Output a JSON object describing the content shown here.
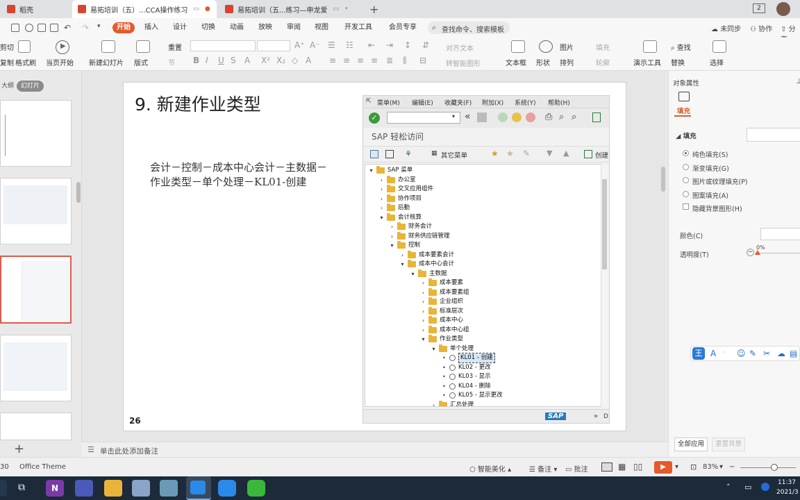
{
  "tabs": [
    {
      "label": "稻壳",
      "icon": "wps-logo-icon"
    },
    {
      "label": "易拓培训（五）...CCA操作练习",
      "icon": "ppt-icon"
    },
    {
      "label": "易拓培训（五...练习—申龙爱",
      "icon": "ppt-icon"
    }
  ],
  "titlebar": {
    "page_badge": "2"
  },
  "menu": {
    "items": [
      "开始",
      "插入",
      "设计",
      "切换",
      "动画",
      "放映",
      "审阅",
      "视图",
      "开发工具",
      "会员专享"
    ],
    "active": "开始",
    "search_placeholder": "查找命令、搜索模板",
    "sync": "未同步",
    "collab": "协作",
    "share": "分享"
  },
  "ribbon": {
    "cut": "剪切",
    "copy": "复制",
    "format_painter": "格式刷",
    "play_from_current": "当页开始",
    "new_slide": "新建幻灯片",
    "layout": "版式",
    "reset": "重置",
    "section": "节",
    "text_box": "文本框",
    "shape": "形状",
    "arrange": "排列",
    "picture": "图片",
    "fill": "填充",
    "outline": "轮廓",
    "find": "查找",
    "replace": "替换",
    "presentation_tools": "演示工具",
    "select": "选择",
    "align_text": "对齐文本",
    "convert_smartart": "转智能图形"
  },
  "leftpanel": {
    "outline_tab": "大纲",
    "slides_tab": "幻灯片",
    "add_label": "+"
  },
  "slide": {
    "title": "9.  新建作业类型",
    "body_line1": "会计－控制－成本中心会计－主数据－",
    "body_line2": "作业类型－单个处理－KL01-创建",
    "number": "26"
  },
  "sap": {
    "menu": [
      "菜单(M)",
      "编辑(E)",
      "收藏夹(F)",
      "附加(X)",
      "系统(Y)",
      "帮助(H)"
    ],
    "title": "SAP 轻松访问",
    "other_menu": "其它菜单",
    "create_role": "创建",
    "tree": [
      {
        "label": "SAP 菜单",
        "depth": 0,
        "toggle": "▾",
        "icon": "folder"
      },
      {
        "label": "办公室",
        "depth": 1,
        "toggle": "›",
        "icon": "folder"
      },
      {
        "label": "交叉应用组件",
        "depth": 1,
        "toggle": "›",
        "icon": "folder"
      },
      {
        "label": "协作项目",
        "depth": 1,
        "toggle": "›",
        "icon": "folder"
      },
      {
        "label": "后勤",
        "depth": 1,
        "toggle": "›",
        "icon": "folder"
      },
      {
        "label": "会计核算",
        "depth": 1,
        "toggle": "▾",
        "icon": "folder"
      },
      {
        "label": "财务会计",
        "depth": 2,
        "toggle": "›",
        "icon": "folder"
      },
      {
        "label": "财务供应链管理",
        "depth": 2,
        "toggle": "›",
        "icon": "folder"
      },
      {
        "label": "控制",
        "depth": 2,
        "toggle": "▾",
        "icon": "folder"
      },
      {
        "label": "成本要素会计",
        "depth": 3,
        "toggle": "›",
        "icon": "folder"
      },
      {
        "label": "成本中心会计",
        "depth": 3,
        "toggle": "▾",
        "icon": "folder"
      },
      {
        "label": "主数据",
        "depth": 4,
        "toggle": "▾",
        "icon": "folder"
      },
      {
        "label": "成本要素",
        "depth": 5,
        "toggle": "›",
        "icon": "folder"
      },
      {
        "label": "成本要素组",
        "depth": 5,
        "toggle": "›",
        "icon": "folder"
      },
      {
        "label": "企业组织",
        "depth": 5,
        "toggle": "›",
        "icon": "folder"
      },
      {
        "label": "标准层次",
        "depth": 5,
        "toggle": "›",
        "icon": "folder"
      },
      {
        "label": "成本中心",
        "depth": 5,
        "toggle": "›",
        "icon": "folder"
      },
      {
        "label": "成本中心组",
        "depth": 5,
        "toggle": "›",
        "icon": "folder"
      },
      {
        "label": "作业类型",
        "depth": 5,
        "toggle": "▾",
        "icon": "folder"
      },
      {
        "label": "单个处理",
        "depth": 6,
        "toggle": "▾",
        "icon": "folder"
      },
      {
        "label": "KL01 - 创建",
        "depth": 7,
        "toggle": "•",
        "icon": "transaction",
        "selected": true
      },
      {
        "label": "KL02 - 更改",
        "depth": 7,
        "toggle": "•",
        "icon": "transaction"
      },
      {
        "label": "KL03 - 显示",
        "depth": 7,
        "toggle": "•",
        "icon": "transaction"
      },
      {
        "label": "KL04 - 删除",
        "depth": 7,
        "toggle": "•",
        "icon": "transaction"
      },
      {
        "label": "KL05 - 显示更改",
        "depth": 7,
        "toggle": "•",
        "icon": "transaction"
      },
      {
        "label": "汇总处理",
        "depth": 6,
        "toggle": "›",
        "icon": "folder"
      }
    ],
    "status_right": "D",
    "logo_text": "SAP"
  },
  "rightpanel": {
    "header": "对象属性",
    "fill_tab": "填充",
    "fill_section": "填充",
    "options": [
      "纯色填充(S)",
      "渐变填充(G)",
      "图片或纹理填充(P)",
      "图案填充(A)"
    ],
    "selected_option": 0,
    "hide_bg": "隐藏背景图形(H)",
    "color_label": "颜色(C)",
    "transparency_label": "透明度(T)",
    "transparency_value": "0%",
    "apply_all": "全部应用",
    "reset_bg": "重置背景"
  },
  "notes": {
    "placeholder": "单击此处添加备注"
  },
  "statusbar": {
    "slide_counter": "30",
    "theme": "Office Theme",
    "beautify": "智能美化",
    "notes": "备注",
    "comments": "批注",
    "zoom": "83%"
  },
  "taskbar": {
    "time": "11:37",
    "date": "2021/3",
    "apps": [
      "task-view-icon",
      "onenote-icon",
      "teams-icon",
      "file-explorer-icon",
      "app-icon",
      "notepad-icon",
      "wps-icon",
      "zoom-icon",
      "wechat-icon"
    ]
  },
  "colors": {
    "accent": "#e45a2a",
    "selected_thumb": "#e05a4a",
    "taskbar": "#1c2a3a",
    "sap_folder": "#e8b53a"
  }
}
